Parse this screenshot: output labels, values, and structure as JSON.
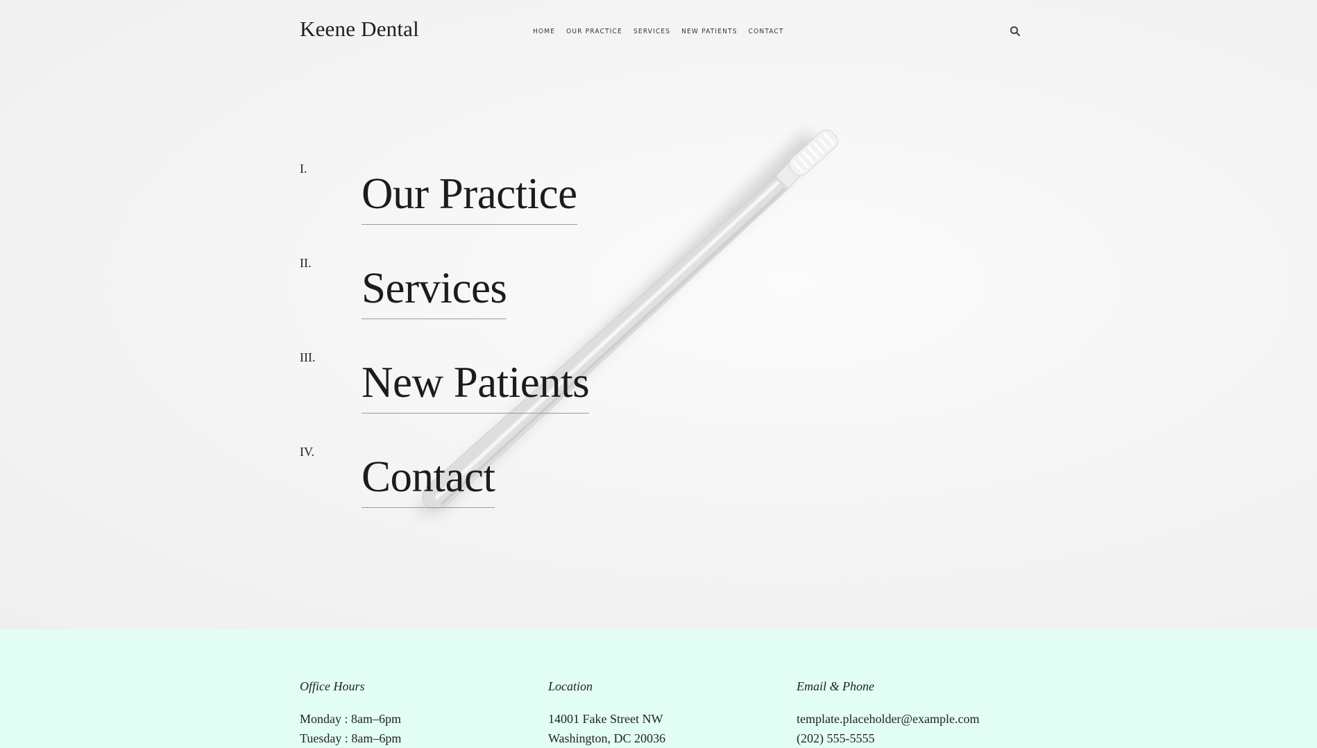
{
  "header": {
    "brand": "Keene Dental",
    "nav": [
      "HOME",
      "OUR PRACTICE",
      "SERVICES",
      "NEW PATIENTS",
      "CONTACT"
    ],
    "search_icon": "search-icon"
  },
  "menu": [
    {
      "number": "I.",
      "label": "Our Practice"
    },
    {
      "number": "II.",
      "label": "Services"
    },
    {
      "number": "III.",
      "label": "New Patients"
    },
    {
      "number": "IV.",
      "label": "Contact"
    }
  ],
  "footer": {
    "background": "#e2fef4",
    "hours": {
      "heading": "Office Hours",
      "lines": [
        "Monday : 8am–6pm",
        "Tuesday : 8am–6pm"
      ]
    },
    "location": {
      "heading": "Location",
      "lines": [
        "14001 Fake Street NW",
        "Washington, DC 20036"
      ]
    },
    "contact": {
      "heading": "Email & Phone",
      "lines": [
        "template.placeholder@example.com",
        "(202) 555-5555"
      ]
    }
  }
}
